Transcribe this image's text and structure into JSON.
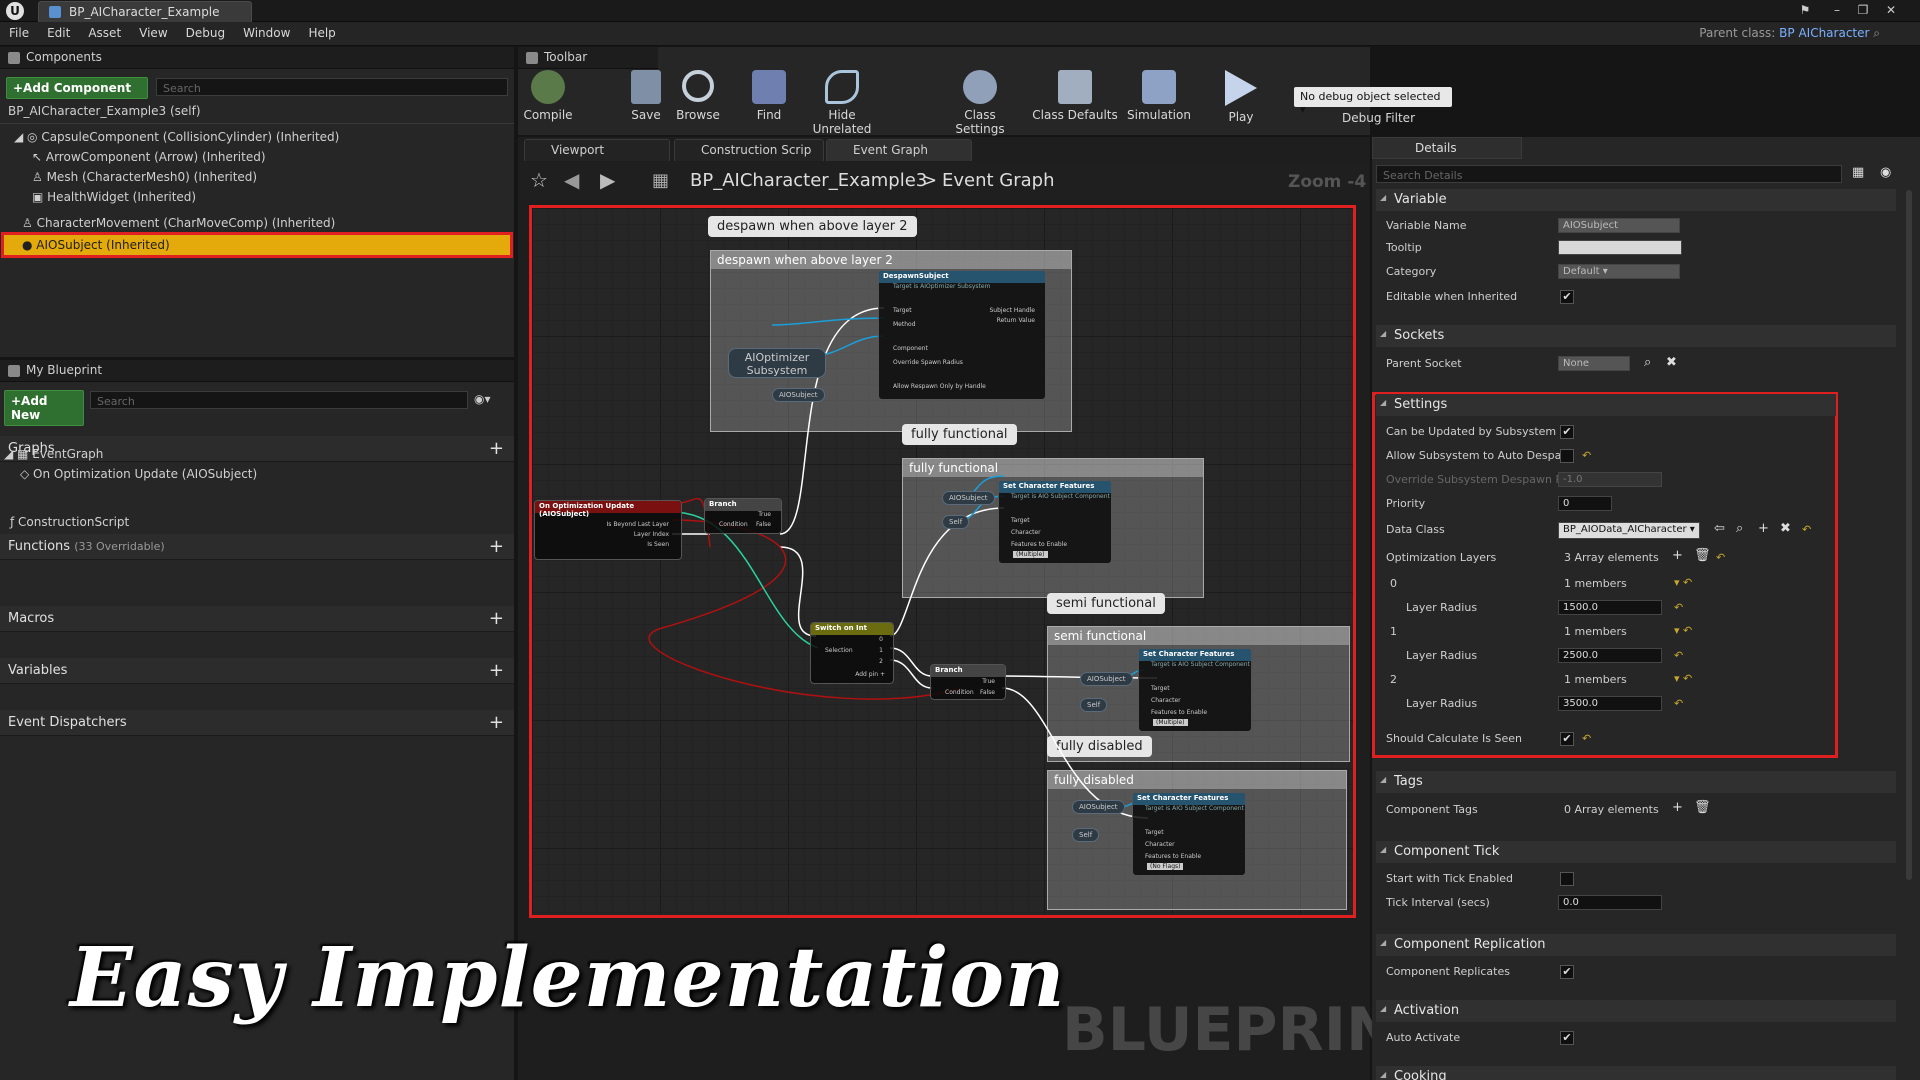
{
  "window": {
    "tab_title": "BP_AICharacter_Example",
    "parent_class_label": "Parent class:",
    "parent_class": "BP AICharacter"
  },
  "menu": [
    "File",
    "Edit",
    "Asset",
    "View",
    "Debug",
    "Window",
    "Help"
  ],
  "components": {
    "title": "Components",
    "add_label": "+Add Component",
    "search_placeholder": "Search",
    "items": [
      "BP_AICharacter_Example3 (self)",
      "CapsuleComponent (CollisionCylinder) (Inherited)",
      "ArrowComponent (Arrow) (Inherited)",
      "Mesh (CharacterMesh0) (Inherited)",
      "HealthWidget (Inherited)",
      "CharacterMovement (CharMoveComp) (Inherited)",
      "AIOSubject (Inherited)"
    ]
  },
  "my_blueprint": {
    "title": "My Blueprint",
    "add_label": "+Add New",
    "search_placeholder": "Search",
    "graphs_label": "Graphs",
    "event_graph": "EventGraph",
    "event_item": "On Optimization Update (AIOSubject)",
    "functions_label": "Functions",
    "functions_count": "(33 Overridable)",
    "construction": "ConstructionScript",
    "macros": "Macros",
    "variables": "Variables",
    "dispatchers": "Event Dispatchers"
  },
  "toolbar": {
    "title": "Toolbar",
    "compile": "Compile",
    "save": "Save",
    "browse": "Browse",
    "find": "Find",
    "hide_unrelated": "Hide Unrelated",
    "class_settings": "Class Settings",
    "class_defaults": "Class Defaults",
    "simulation": "Simulation",
    "play": "Play",
    "debug_select": "No debug object selected",
    "debug_filter": "Debug Filter"
  },
  "graph_tabs": [
    "Viewport",
    "Construction Scrip",
    "Event Graph"
  ],
  "graph": {
    "breadcrumb_bp": "BP_AICharacter_Example3",
    "breadcrumb_sep": ">",
    "breadcrumb_graph": "Event Graph",
    "zoom": "Zoom -4",
    "comments": [
      "despawn when above layer 2",
      "fully functional",
      "semi functional",
      "fully disabled"
    ],
    "nodes": {
      "event": "On Optimization Update (AIOSubject)",
      "event_pins": [
        "Is Beyond Last Layer",
        "Layer Index",
        "Is Seen"
      ],
      "branch": "Branch",
      "branch_pins": [
        "Condition",
        "True",
        "False"
      ],
      "switch": "Switch on Int",
      "switch_pins": [
        "Selection",
        "0",
        "1",
        "2",
        "Add pin +"
      ],
      "despawn": "DespawnSubject",
      "despawn_sub": "Target is AIOptimizer Subsystem",
      "despawn_pins": [
        "Target",
        "Method",
        "Component",
        "Override Spawn Radius",
        "Allow Respawn Only by Handle",
        "Subject Handle",
        "Return Value"
      ],
      "subsystem": "AIOptimizer Subsystem",
      "aiosubject": "AIOSubject",
      "self": "Self",
      "set_features": "Set Character Features",
      "set_sub": "Target is AIO Subject Component",
      "set_pins": [
        "Target",
        "Character",
        "Features to Enable"
      ],
      "feat_multiple": "(Multiple)",
      "feat_none": "(No Flags)"
    }
  },
  "details": {
    "title": "Details",
    "search_placeholder": "Search Details",
    "variable": {
      "header": "Variable",
      "name_label": "Variable Name",
      "name_value": "AIOSubject",
      "tooltip_label": "Tooltip",
      "category_label": "Category",
      "category_value": "Default",
      "editable_label": "Editable when Inherited"
    },
    "sockets": {
      "header": "Sockets",
      "parent_label": "Parent Socket",
      "parent_value": "None"
    },
    "settings": {
      "header": "Settings",
      "can_update": "Can be Updated by Subsystem",
      "allow_despawn": "Allow Subsystem to Auto Despaw",
      "override_label": "Override Subsystem Despawn Ra",
      "override_value": "-1.0",
      "priority_label": "Priority",
      "priority_value": "0",
      "data_class_label": "Data Class",
      "data_class_value": "BP_AIOData_AICharacter",
      "layers_label": "Optimization Layers",
      "layers_value": "3 Array elements",
      "layers": [
        {
          "index": "0",
          "members": "1 members",
          "radius_label": "Layer Radius",
          "radius": "1500.0"
        },
        {
          "index": "1",
          "members": "1 members",
          "radius_label": "Layer Radius",
          "radius": "2500.0"
        },
        {
          "index": "2",
          "members": "1 members",
          "radius_label": "Layer Radius",
          "radius": "3500.0"
        }
      ],
      "calc_seen": "Should Calculate Is Seen"
    },
    "tags": {
      "header": "Tags",
      "label": "Component Tags",
      "value": "0 Array elements"
    },
    "tick": {
      "header": "Component Tick",
      "start_label": "Start with Tick Enabled",
      "interval_label": "Tick Interval (secs)",
      "interval_value": "0.0"
    },
    "replication": {
      "header": "Component Replication",
      "label": "Component Replicates"
    },
    "activation": {
      "header": "Activation",
      "label": "Auto Activate"
    },
    "cooking": {
      "header": "Cooking"
    }
  },
  "overlay": {
    "caption": "Easy Implementation",
    "watermark": "BLUEPRINT"
  },
  "colors": {
    "accent_red": "#e02020",
    "selection": "#e4a90a",
    "exec_wire": "#ffffff",
    "bool_wire": "#b01010",
    "obj_wire": "#1a9fd8",
    "int_wire": "#2ad3a0"
  }
}
